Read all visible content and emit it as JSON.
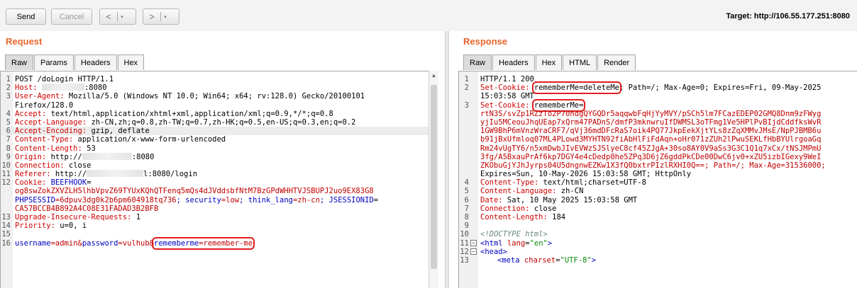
{
  "toolbar": {
    "send": "Send",
    "cancel": "Cancel",
    "back_arrow": "<",
    "forward_arrow": ">",
    "dropdown": "▾",
    "target": "Target: http://106.55.177.251:8080"
  },
  "request": {
    "title": "Request",
    "tabs": [
      "Raw",
      "Params",
      "Headers",
      "Hex"
    ],
    "lines": {
      "l1": "POST /doLogin HTTP/1.1",
      "l2_key": "Host:",
      "l2_val": ":8080",
      "l3_key": "User-Agent:",
      "l3_val": " Mozilla/5.0 (Windows NT 10.0; Win64; x64; rv:128.0) Gecko/20100101",
      "l3b": "Firefox/128.0",
      "l4_key": "Accept:",
      "l4_val": " text/html,application/xhtml+xml,application/xml;q=0.9,*/*;q=0.8",
      "l5_key": "Accept-Language:",
      "l5_val": " zh-CN,zh;q=0.8,zh-TW;q=0.7,zh-HK;q=0.5,en-US;q=0.3,en;q=0.2",
      "l6_key": "Accept-Encoding:",
      "l6_val": " gzip, deflate",
      "l7_key": "Content-Type:",
      "l7_val": " application/x-www-form-urlencoded",
      "l8_key": "Content-Length:",
      "l8_val": " 53",
      "l9_key": "Origin:",
      "l9_val1": " http://",
      "l9_val2": ":8080",
      "l10_key": "Connection:",
      "l10_val": " close",
      "l11_key": "Referer:",
      "l11_val1": " http://",
      "l11_val2": "l:8080/login",
      "l12_key": "Cookie:",
      "l12_c1k": " BEEFHOOK",
      "l12_eq": "=",
      "l12b": "og8swZokZXVZLH5lhbVpvZ69TYUxKQhQTFenq5mQs4dJVddsbfNtM7BzGPdWHHTVJSBUPJ2uo9EX83G8",
      "l12c1": "PHPSESSID",
      "l12c1v": "=6dpuv3dg0k2b6pm604918tq736",
      "l12c2": "; security",
      "l12c2v": "=low",
      "l12c3": "; think_lang",
      "l12c3v": "=zh-cn",
      "l12c4": "; JSESSIONID",
      "l12c4e": "=",
      "l12d": "CA57BCCB4B892A4C08E31FADAD3B2BFB",
      "l13_key": "Upgrade-Insecure-Requests:",
      "l13_val": " 1",
      "l14_key": "Priority:",
      "l14_val": " u=0, i",
      "body_k1": "username",
      "body_v1": "=admin&",
      "body_k2": "password",
      "body_v2": "=vulhub&",
      "body_k3": "rememberme",
      "body_v3": "=remember-me"
    }
  },
  "response": {
    "title": "Response",
    "tabs": [
      "Raw",
      "Headers",
      "Hex",
      "HTML",
      "Render"
    ],
    "lines": {
      "l1": "HTTP/1.1 200",
      "l2_key": "Set-Cookie:",
      "l2_hl": "rememberMe=deleteMe",
      "l2_rest": "; Path=/; Max-Age=0; Expires=Fri, 09-May-2025",
      "l2b": "15:03:58 GMT",
      "l3_key": "Set-Cookie:",
      "l3_hl": "rememberMe=",
      "c1": "rtN3S/svZp1RZzTo2P70ndgQYGQDr5aqqwbFqHjYyMVY/pSCh5lm7FCazEDEP02GMQ8Dnm9zFWyg",
      "c2": "yjIu5MCeouJhqUEap7xQrm47PADnS/dmfP3mknwruIfDWMSL3oTFmg1Ve5HPlPvBIjdCddfksWvR",
      "c3": "1GW9BhP6mVnzWraCRF7/qVj36mdDFcRaS7oik4PQ77JkpEekXjtYLs8zZqXMMvJMsE/NpPJBMB6u",
      "c4": "b91jBxUfmloq07ML4PLowd3MYHTN92fiAbHlFiFdAqn+oHr071zZUh2lPwuSEKLfHbBYUlrgoaGq",
      "c5": "Rm24vUgTY6/n5xmDwbJIvEVWzSJSlyeC8cf45ZJgA+30so8AY0V9aSs3G3C1Q1q7xCx/tNSJMPmU",
      "c6": "3fg/A5BxauPrAf6kp7DGY4e4cDedp0he5ZPq3D6jZ6gddPkCDe00DwC6jv0+xZU5izbIGexy9WeI",
      "c7": "ZKObuGjYJhJyrps04U5dngnwEZKw1X3fQ0bxtrPIzlRXHI0Q==; Path=/; Max-Age=31536000;",
      "c8": "Expires=Sun, 10-May-2026 15:03:58 GMT; HttpOnly",
      "l4_key": "Content-Type:",
      "l4_val": " text/html;charset=UTF-8",
      "l5_key": "Content-Language:",
      "l5_val": " zh-CN",
      "l6_key": "Date:",
      "l6_val": " Sat, 10 May 2025 15:03:58 GMT",
      "l7_key": "Connection:",
      "l7_val": " close",
      "l8_key": "Content-Length:",
      "l8_val": " 184",
      "l10": "<!DOCTYPE html>",
      "l11_tag": "<html ",
      "l11_attr": "lang",
      "l11_eq": "=",
      "l11_v": "\"en\"",
      "l11_end": ">",
      "l12": "<head>",
      "l13_tag": "<meta ",
      "l13_attr": "charset",
      "l13_eq": "=",
      "l13_v": "\"UTF-8\"",
      "l13_end": ">"
    }
  }
}
